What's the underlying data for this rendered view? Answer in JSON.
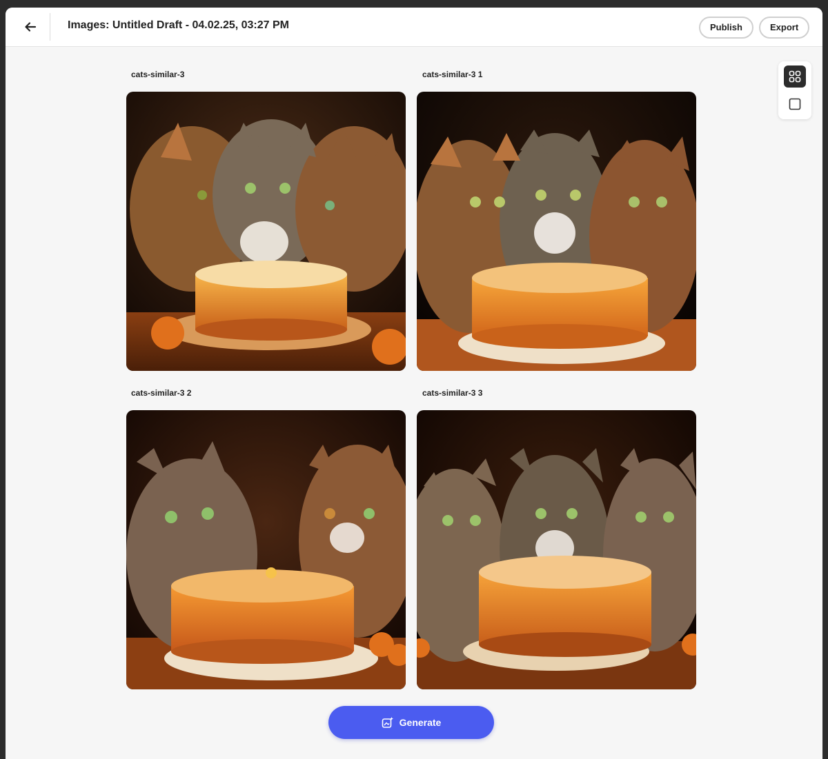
{
  "header": {
    "title": "Images: Untitled Draft - 04.02.25, 03:27 PM",
    "publish_label": "Publish",
    "export_label": "Export"
  },
  "images": [
    {
      "label": "cats-similar-3"
    },
    {
      "label": "cats-similar-3 1"
    },
    {
      "label": "cats-similar-3 2"
    },
    {
      "label": "cats-similar-3 3"
    }
  ],
  "generate_label": "Generate",
  "colors": {
    "accent": "#4b5cf0",
    "page_bg": "#f6f6f6"
  },
  "icons": {
    "back": "arrow-left-icon",
    "grid_view": "grid-icon",
    "single_view": "square-icon",
    "generate": "sparkle-image-icon"
  }
}
